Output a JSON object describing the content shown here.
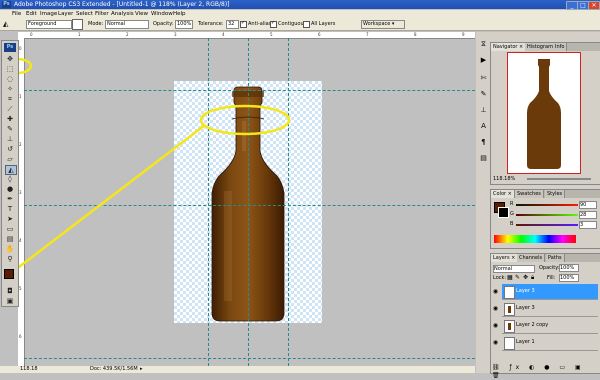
{
  "app": {
    "title": "Adobe Photoshop CS3 Extended - [Untitled-1 @ 118% (Layer 2, RGB/8)]",
    "icon_text": "Ps"
  },
  "window_controls": {
    "minimize": "_",
    "maximize": "□",
    "close": "✕"
  },
  "menu": [
    "File",
    "Edit",
    "Image",
    "Layer",
    "Select",
    "Filter",
    "Analysis",
    "View",
    "Window",
    "Help"
  ],
  "options": {
    "fill_source": "Foreground",
    "mode_label": "Mode:",
    "mode_value": "Normal",
    "opacity_label": "Opacity:",
    "opacity_value": "100%",
    "tolerance_label": "Tolerance:",
    "tolerance_value": "32",
    "antialias_label": "Anti-alias",
    "contiguous_label": "Contiguous",
    "all_layers_label": "All Layers",
    "workspace_label": "Workspace ▾"
  },
  "rulers": {
    "top": [
      "0",
      "1",
      "2",
      "3",
      "4",
      "5",
      "6",
      "7",
      "8",
      "9"
    ],
    "left": [
      "0",
      "1",
      "2",
      "3",
      "4",
      "5",
      "6"
    ]
  },
  "status": {
    "zoom": "118.18",
    "doc": "Doc: 439.5K/1.56M"
  },
  "navigator": {
    "tabs": [
      "Navigator ×",
      "Histogram",
      "Info"
    ],
    "zoom": "118.18%"
  },
  "color_panel": {
    "tabs": [
      "Color ×",
      "Swatches",
      "Styles"
    ],
    "channels": [
      {
        "label": "R",
        "value": "90"
      },
      {
        "label": "G",
        "value": "28"
      },
      {
        "label": "B",
        "value": "3"
      }
    ],
    "foreground": "#5a1c03"
  },
  "layers_panel": {
    "tabs": [
      "Layers ×",
      "Channels",
      "Paths"
    ],
    "blend": "Normal",
    "opacity_label": "Opacity:",
    "opacity_value": "100%",
    "lock_label": "Lock:",
    "fill_label": "Fill:",
    "fill_value": "100%",
    "layers": [
      {
        "name": "Layer 3",
        "selected": true
      },
      {
        "name": "Layer 3",
        "selected": false
      },
      {
        "name": "Layer 2 copy",
        "selected": false
      },
      {
        "name": "Layer 1",
        "selected": false
      }
    ]
  },
  "colors": {
    "accent": "#3399ff",
    "annotation": "#f5e61a",
    "bottle": "#6b3a0a"
  }
}
